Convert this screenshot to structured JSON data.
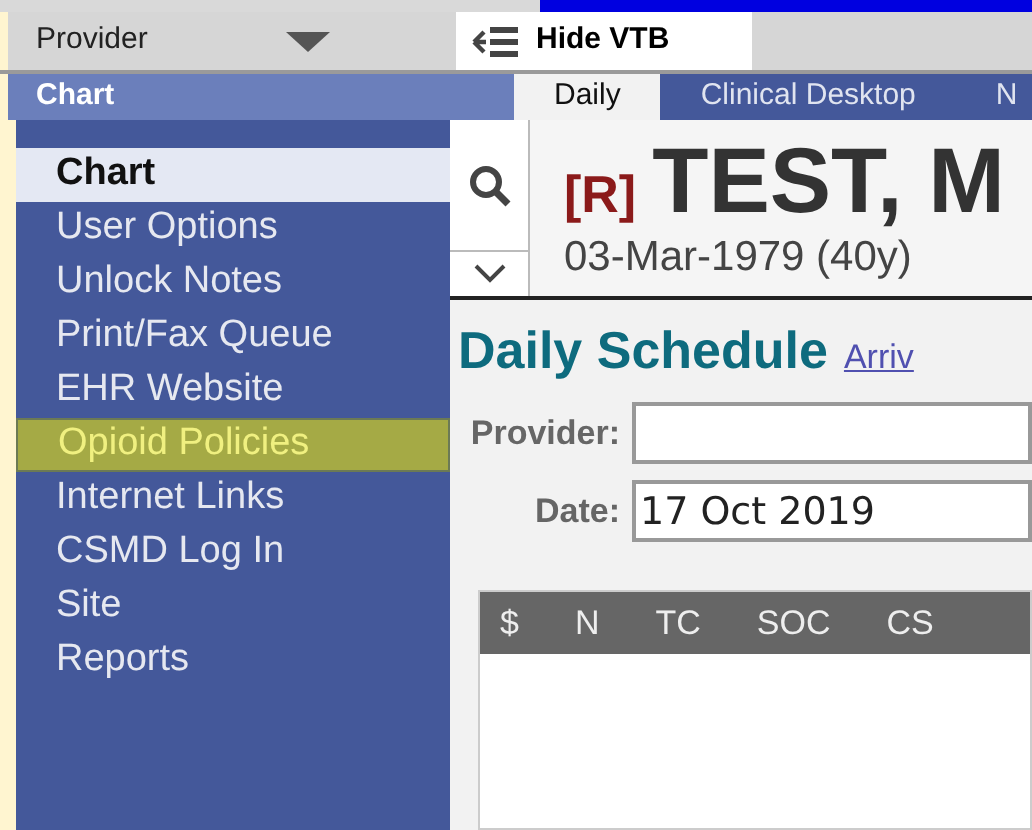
{
  "provider_dropdown": {
    "value": "Provider"
  },
  "hide_button": {
    "label": "Hide VTB"
  },
  "sidebar": {
    "title": "Chart",
    "items": [
      {
        "label": "Chart",
        "selected": true,
        "hovered": false
      },
      {
        "label": "User Options",
        "selected": false,
        "hovered": false
      },
      {
        "label": "Unlock Notes",
        "selected": false,
        "hovered": false
      },
      {
        "label": "Print/Fax Queue",
        "selected": false,
        "hovered": false
      },
      {
        "label": "EHR Website",
        "selected": false,
        "hovered": false
      },
      {
        "label": "Opioid Policies",
        "selected": false,
        "hovered": true
      },
      {
        "label": "Internet Links",
        "selected": false,
        "hovered": false
      },
      {
        "label": "CSMD Log In",
        "selected": false,
        "hovered": false
      },
      {
        "label": "Site",
        "selected": false,
        "hovered": false
      },
      {
        "label": "Reports",
        "selected": false,
        "hovered": false
      }
    ]
  },
  "tabs": [
    {
      "label": "Daily",
      "selected": true
    },
    {
      "label": "Clinical Desktop",
      "selected": false
    },
    {
      "label": "N",
      "selected": false
    }
  ],
  "patient": {
    "flag": "[R]",
    "name": "TEST, M",
    "details": "03-Mar-1979 (40y)"
  },
  "schedule": {
    "title": "Daily Schedule",
    "link": "Arriv",
    "fields": [
      {
        "label": "Provider:"
      },
      {
        "label": "Date:",
        "value": "17 Oct 2019"
      }
    ],
    "columns": [
      "$",
      "N",
      "TC",
      "SOC",
      "CS"
    ]
  }
}
